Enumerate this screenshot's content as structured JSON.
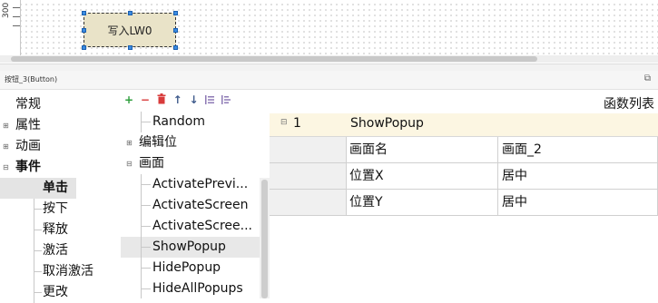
{
  "canvas": {
    "ruler_label": "300",
    "button_text": "写入LW0"
  },
  "properties": {
    "title": "按钮_3(Button)",
    "categories": [
      {
        "label": "常规",
        "expand": ""
      },
      {
        "label": "属性",
        "expand": "⊞"
      },
      {
        "label": "动画",
        "expand": "⊞"
      },
      {
        "label": "事件",
        "expand": "⊟"
      }
    ],
    "events": [
      "单击",
      "按下",
      "释放",
      "激活",
      "取消激活",
      "更改"
    ],
    "selected_event": "单击"
  },
  "toolbar": {
    "add": "+",
    "remove": "−",
    "delete_icon": "trash-icon",
    "up": "↑",
    "down": "↓"
  },
  "function_tree": [
    {
      "label": "Random",
      "type": "leaf"
    },
    {
      "label": "编辑位",
      "type": "group",
      "expand": "⊞"
    },
    {
      "label": "画面",
      "type": "group",
      "expand": "⊟"
    },
    {
      "label": "ActivatePrevi...",
      "type": "leaf"
    },
    {
      "label": "ActivateScreen",
      "type": "leaf"
    },
    {
      "label": "ActivateScree...",
      "type": "leaf"
    },
    {
      "label": "ShowPopup",
      "type": "leaf",
      "selected": true
    },
    {
      "label": "HidePopup",
      "type": "leaf"
    },
    {
      "label": "HideAllPopups",
      "type": "leaf"
    }
  ],
  "function_list": {
    "title": "函数列表",
    "entry": {
      "expand": "⊟",
      "index": "1",
      "function": "ShowPopup"
    },
    "params": [
      {
        "name": "画面名",
        "value": "画面_2"
      },
      {
        "name": "位置X",
        "value": "居中"
      },
      {
        "name": "位置Y",
        "value": "居中"
      }
    ]
  },
  "colors": {
    "add": "#2e9e3c",
    "remove": "#d83b3b",
    "delete": "#d83b3b",
    "arrows": "#3f5b8c",
    "header_bg": "#fcf6e2",
    "selection_handle": "#3a8be0"
  }
}
